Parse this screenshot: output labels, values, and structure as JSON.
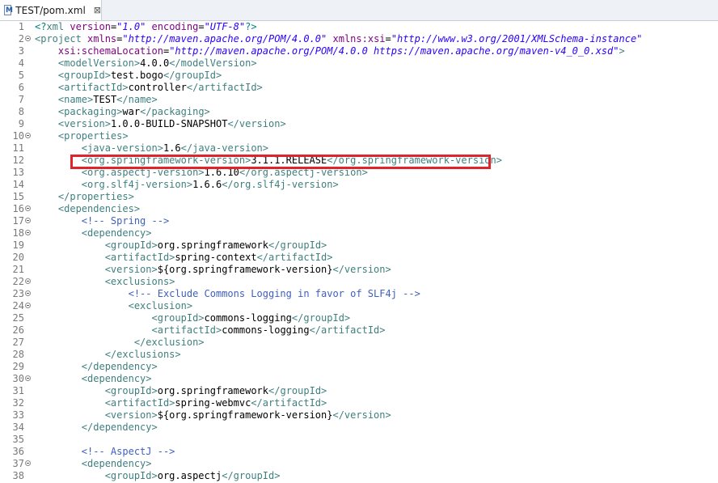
{
  "tab": {
    "title": "TEST/pom.xml",
    "close": "⊠"
  },
  "lines": [
    {
      "n": "1",
      "fold": false,
      "indent": 0,
      "parts": [
        [
          "d",
          "<?"
        ],
        [
          "t",
          "xml"
        ],
        [
          "a",
          " version"
        ],
        [
          "x",
          "="
        ],
        [
          "v",
          "\"1.0\""
        ],
        [
          "a",
          " encoding"
        ],
        [
          "x",
          "="
        ],
        [
          "v",
          "\"UTF-8\""
        ],
        [
          "d",
          "?>"
        ]
      ]
    },
    {
      "n": "2",
      "fold": true,
      "indent": 0,
      "parts": [
        [
          "t",
          "<project"
        ],
        [
          "a",
          " xmlns"
        ],
        [
          "x",
          "="
        ],
        [
          "v",
          "\"http://maven.apache.org/POM/4.0.0\""
        ],
        [
          "a",
          " xmlns:xsi"
        ],
        [
          "x",
          "="
        ],
        [
          "v",
          "\"http://www.w3.org/2001/XMLSchema-instance\""
        ]
      ]
    },
    {
      "n": "3",
      "fold": false,
      "indent": 4,
      "parts": [
        [
          "a",
          "xsi:schemaLocation"
        ],
        [
          "x",
          "="
        ],
        [
          "v",
          "\"http://maven.apache.org/POM/4.0.0 https://maven.apache.org/maven-v4_0_0.xsd\""
        ],
        [
          "t",
          ">"
        ]
      ]
    },
    {
      "n": "4",
      "fold": false,
      "indent": 4,
      "parts": [
        [
          "t",
          "<modelVersion>"
        ],
        [
          "x",
          "4.0.0"
        ],
        [
          "t",
          "</modelVersion>"
        ]
      ]
    },
    {
      "n": "5",
      "fold": false,
      "indent": 4,
      "parts": [
        [
          "t",
          "<groupId>"
        ],
        [
          "x",
          "test.bogo"
        ],
        [
          "t",
          "</groupId>"
        ]
      ]
    },
    {
      "n": "6",
      "fold": false,
      "indent": 4,
      "parts": [
        [
          "t",
          "<artifactId>"
        ],
        [
          "x",
          "controller"
        ],
        [
          "t",
          "</artifactId>"
        ]
      ]
    },
    {
      "n": "7",
      "fold": false,
      "indent": 4,
      "parts": [
        [
          "t",
          "<name>"
        ],
        [
          "x",
          "TEST"
        ],
        [
          "t",
          "</name>"
        ]
      ]
    },
    {
      "n": "8",
      "fold": false,
      "indent": 4,
      "parts": [
        [
          "t",
          "<packaging>"
        ],
        [
          "x",
          "war"
        ],
        [
          "t",
          "</packaging>"
        ]
      ]
    },
    {
      "n": "9",
      "fold": false,
      "indent": 4,
      "parts": [
        [
          "t",
          "<version>"
        ],
        [
          "x",
          "1.0.0-BUILD-SNAPSHOT"
        ],
        [
          "t",
          "</version>"
        ]
      ]
    },
    {
      "n": "10",
      "fold": true,
      "indent": 4,
      "parts": [
        [
          "t",
          "<properties>"
        ]
      ]
    },
    {
      "n": "11",
      "fold": false,
      "indent": 8,
      "parts": [
        [
          "t",
          "<java-version>"
        ],
        [
          "x",
          "1.6"
        ],
        [
          "t",
          "</java-version>"
        ]
      ]
    },
    {
      "n": "12",
      "fold": false,
      "indent": 8,
      "parts": [
        [
          "t",
          "<org.springframework-version>"
        ],
        [
          "x",
          "3.1.1.RELEASE"
        ],
        [
          "t",
          "</org.springframework-version>"
        ]
      ]
    },
    {
      "n": "13",
      "fold": false,
      "indent": 8,
      "parts": [
        [
          "t",
          "<org.aspectj-version>"
        ],
        [
          "x",
          "1.6.10"
        ],
        [
          "t",
          "</org.aspectj-version>"
        ]
      ]
    },
    {
      "n": "14",
      "fold": false,
      "indent": 8,
      "parts": [
        [
          "t",
          "<org.slf4j-version>"
        ],
        [
          "x",
          "1.6.6"
        ],
        [
          "t",
          "</org.slf4j-version>"
        ]
      ]
    },
    {
      "n": "15",
      "fold": false,
      "indent": 4,
      "parts": [
        [
          "t",
          "</properties>"
        ]
      ]
    },
    {
      "n": "16",
      "fold": true,
      "indent": 4,
      "parts": [
        [
          "t",
          "<dependencies>"
        ]
      ]
    },
    {
      "n": "17",
      "fold": true,
      "indent": 8,
      "parts": [
        [
          "c",
          "<!-- Spring -->"
        ]
      ]
    },
    {
      "n": "18",
      "fold": true,
      "indent": 8,
      "parts": [
        [
          "t",
          "<dependency>"
        ]
      ]
    },
    {
      "n": "19",
      "fold": false,
      "indent": 12,
      "parts": [
        [
          "t",
          "<groupId>"
        ],
        [
          "x",
          "org.springframework"
        ],
        [
          "t",
          "</groupId>"
        ]
      ]
    },
    {
      "n": "20",
      "fold": false,
      "indent": 12,
      "parts": [
        [
          "t",
          "<artifactId>"
        ],
        [
          "x",
          "spring-context"
        ],
        [
          "t",
          "</artifactId>"
        ]
      ]
    },
    {
      "n": "21",
      "fold": false,
      "indent": 12,
      "parts": [
        [
          "t",
          "<version>"
        ],
        [
          "x",
          "${org.springframework-version}"
        ],
        [
          "t",
          "</version>"
        ]
      ]
    },
    {
      "n": "22",
      "fold": true,
      "indent": 12,
      "parts": [
        [
          "t",
          "<exclusions>"
        ]
      ]
    },
    {
      "n": "23",
      "fold": true,
      "indent": 16,
      "parts": [
        [
          "c",
          "<!-- Exclude Commons Logging in favor of SLF4j -->"
        ]
      ]
    },
    {
      "n": "24",
      "fold": true,
      "indent": 16,
      "parts": [
        [
          "t",
          "<exclusion>"
        ]
      ]
    },
    {
      "n": "25",
      "fold": false,
      "indent": 20,
      "parts": [
        [
          "t",
          "<groupId>"
        ],
        [
          "x",
          "commons-logging"
        ],
        [
          "t",
          "</groupId>"
        ]
      ]
    },
    {
      "n": "26",
      "fold": false,
      "indent": 20,
      "parts": [
        [
          "t",
          "<artifactId>"
        ],
        [
          "x",
          "commons-logging"
        ],
        [
          "t",
          "</artifactId>"
        ]
      ]
    },
    {
      "n": "27",
      "fold": false,
      "indent": 17,
      "parts": [
        [
          "t",
          "</exclusion>"
        ]
      ]
    },
    {
      "n": "28",
      "fold": false,
      "indent": 12,
      "parts": [
        [
          "t",
          "</exclusions>"
        ]
      ]
    },
    {
      "n": "29",
      "fold": false,
      "indent": 8,
      "parts": [
        [
          "t",
          "</dependency>"
        ]
      ]
    },
    {
      "n": "30",
      "fold": true,
      "indent": 8,
      "parts": [
        [
          "t",
          "<dependency>"
        ]
      ]
    },
    {
      "n": "31",
      "fold": false,
      "indent": 12,
      "parts": [
        [
          "t",
          "<groupId>"
        ],
        [
          "x",
          "org.springframework"
        ],
        [
          "t",
          "</groupId>"
        ]
      ]
    },
    {
      "n": "32",
      "fold": false,
      "indent": 12,
      "parts": [
        [
          "t",
          "<artifactId>"
        ],
        [
          "x",
          "spring-webmvc"
        ],
        [
          "t",
          "</artifactId>"
        ]
      ]
    },
    {
      "n": "33",
      "fold": false,
      "indent": 12,
      "parts": [
        [
          "t",
          "<version>"
        ],
        [
          "x",
          "${org.springframework-version}"
        ],
        [
          "t",
          "</version>"
        ]
      ]
    },
    {
      "n": "34",
      "fold": false,
      "indent": 8,
      "parts": [
        [
          "t",
          "</dependency>"
        ]
      ]
    },
    {
      "n": "35",
      "fold": false,
      "indent": 0,
      "parts": []
    },
    {
      "n": "36",
      "fold": false,
      "indent": 8,
      "parts": [
        [
          "c",
          "<!-- AspectJ -->"
        ]
      ]
    },
    {
      "n": "37",
      "fold": true,
      "indent": 8,
      "parts": [
        [
          "t",
          "<dependency>"
        ]
      ]
    },
    {
      "n": "38",
      "fold": false,
      "indent": 12,
      "parts": [
        [
          "t",
          "<groupId>"
        ],
        [
          "x",
          "org.aspectj"
        ],
        [
          "t",
          "</groupId>"
        ]
      ]
    }
  ],
  "colors": {
    "tag": "#3f7f7f",
    "attribute": "#7f007f",
    "value": "#2a00ff",
    "comment": "#3f5fbf",
    "highlight_box": "#e0242b"
  }
}
